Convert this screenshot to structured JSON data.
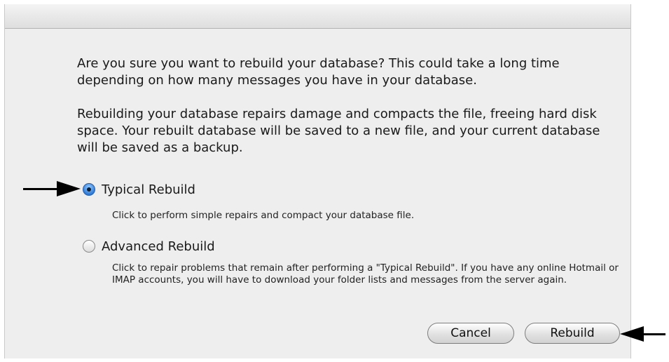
{
  "dialog": {
    "message_primary": "Are you sure you want to rebuild your database? This could take a long time depending on how many messages you have in your database.",
    "message_secondary": "Rebuilding your database repairs damage and compacts the file, freeing hard disk space. Your rebuilt database will be saved to a new file, and your current database will be saved as a backup.",
    "options": [
      {
        "label": "Typical Rebuild",
        "selected": true,
        "description": "Click to perform simple repairs and compact your database file."
      },
      {
        "label": "Advanced Rebuild",
        "selected": false,
        "description": "Click to repair problems that remain after performing a \"Typical Rebuild\". If you have any online Hotmail or IMAP accounts, you will have to download your folder lists and messages from the server again."
      }
    ],
    "buttons": {
      "cancel_label": "Cancel",
      "rebuild_label": "Rebuild"
    }
  },
  "annotations": {
    "arrow_color": "#000000",
    "icons": [
      "arrow-right-icon",
      "arrow-left-icon"
    ]
  },
  "colors": {
    "dialog_background": "#eeeeee",
    "radio_selected": "#3a86df"
  }
}
